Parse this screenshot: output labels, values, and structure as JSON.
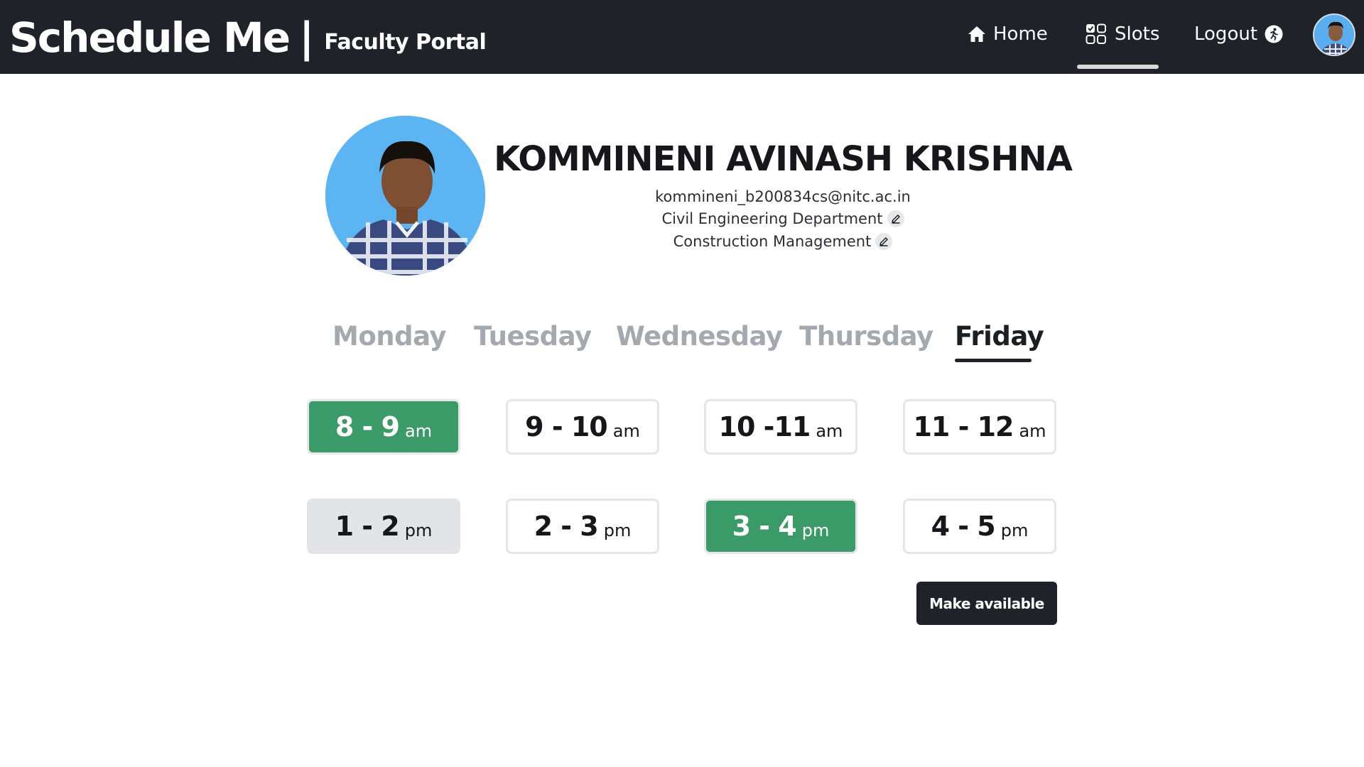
{
  "header": {
    "brand_title": "Schedule Me",
    "brand_separator": "|",
    "brand_subtitle": "Faculty Portal",
    "nav": {
      "home_label": "Home",
      "slots_label": "Slots",
      "logout_label": "Logout"
    },
    "active_nav": "Slots"
  },
  "profile": {
    "name": "KOMMINENI AVINASH KRISHNA",
    "email": "kommineni_b200834cs@nitc.ac.in",
    "department": "Civil Engineering Department",
    "specialization": "Construction Management"
  },
  "days": [
    "Monday",
    "Tuesday",
    "Wednesday",
    "Thursday",
    "Friday"
  ],
  "active_day": "Friday",
  "slots": [
    {
      "main": "8 - 9",
      "suffix": "am",
      "state": "selected"
    },
    {
      "main": "9 - 10",
      "suffix": "am",
      "state": "default"
    },
    {
      "main": "10 -11",
      "suffix": "am",
      "state": "default"
    },
    {
      "main": "11 - 12",
      "suffix": "am",
      "state": "default"
    },
    {
      "main": "1 - 2",
      "suffix": "pm",
      "state": "disabled"
    },
    {
      "main": "2 - 3",
      "suffix": "pm",
      "state": "default"
    },
    {
      "main": "3 - 4",
      "suffix": "pm",
      "state": "selected"
    },
    {
      "main": "4 - 5",
      "suffix": "pm",
      "state": "default"
    }
  ],
  "actions": {
    "make_available_label": "Make available"
  },
  "colors": {
    "navbar_bg": "#1f2228",
    "selected_slot": "#3a9a68",
    "disabled_slot": "#e2e4e8",
    "inactive_tab": "#a4a9b0"
  }
}
